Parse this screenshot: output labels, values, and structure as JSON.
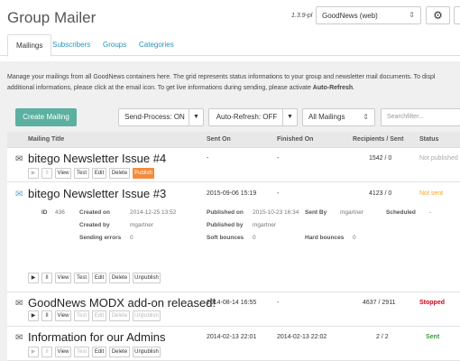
{
  "header": {
    "title": "Group Mailer",
    "version": "1.3.9-pl",
    "container": "GoodNews (web)",
    "settings_icon": "gear-icon",
    "help_icon": "help-icon"
  },
  "tabs": [
    {
      "label": "Mailings",
      "active": true
    },
    {
      "label": "Subscribers"
    },
    {
      "label": "Groups"
    },
    {
      "label": "Categories"
    }
  ],
  "intro": {
    "line1": "Manage your mailings from all GoodNews containers here. The grid represents status informations to your group and newsletter mail documents. To displ",
    "line2_prefix": "additional informations, please click at the email icon. To get live informations during sending, please activate ",
    "line2_bold": "Auto-Refresh",
    "line2_suffix": "."
  },
  "toolbar": {
    "create_label": "Create Mailing",
    "send_process_label": "Send-Process: ON",
    "auto_refresh_label": "Auto-Refresh: OFF",
    "filter_value": "All Mailings",
    "search_placeholder": "Searchfilter..."
  },
  "columns": {
    "title": "Mailing Title",
    "sent_on": "Sent On",
    "finished_on": "Finished On",
    "recipients": "Recipients / Sent",
    "status": "Status"
  },
  "action_labels": {
    "play": "▶",
    "pause": "II",
    "view": "View",
    "test": "Test",
    "edit": "Edit",
    "delete": "Delete",
    "publish": "Publish",
    "unpublish": "Unpublish"
  },
  "rows": [
    {
      "title": "bitego Newsletter Issue #4",
      "sent_on": "-",
      "finished_on": "-",
      "recipients": "1542 / 0",
      "status": "Not published",
      "status_color": "#aaaaaa",
      "publish_action": "Publish"
    },
    {
      "title": "bitego Newsletter Issue #3",
      "sent_on": "2015-09-06 15:19",
      "finished_on": "-",
      "recipients": "4123 / 0",
      "status": "Not sent",
      "status_color": "#f5a623",
      "publish_action": "Unpublish",
      "details": {
        "id_label": "ID",
        "id_value": "436",
        "created_on_label": "Created on",
        "created_on_value": "2014-12-25 13:52",
        "created_by_label": "Created by",
        "created_by_value": "mgartner",
        "sending_errors_label": "Sending errors",
        "sending_errors_value": "0",
        "published_on_label": "Published on",
        "published_on_value": "2015-10-23 16:34",
        "published_by_label": "Published by",
        "published_by_value": "mgartner",
        "soft_bounces_label": "Soft bounces",
        "soft_bounces_value": "0",
        "sent_by_label": "Sent By",
        "sent_by_value": "mgartner",
        "hard_bounces_label": "Hard bounces",
        "hard_bounces_value": "0",
        "scheduled_label": "Scheduled",
        "scheduled_value": "-"
      }
    },
    {
      "title": "GoodNews MODX add-on released!",
      "sent_on": "2014-08-14 16:55",
      "finished_on": "-",
      "recipients": "4637 / 2911",
      "status": "Stopped",
      "status_color": "#d0021b",
      "publish_action": "Unpublish"
    },
    {
      "title": "Information for our Admins",
      "sent_on": "2014-02-13 22:01",
      "finished_on": "2014-02-13 22:02",
      "recipients": "2 / 2",
      "status": "Sent",
      "status_color": "#3a9d3a",
      "publish_action": "Unpublish"
    }
  ]
}
